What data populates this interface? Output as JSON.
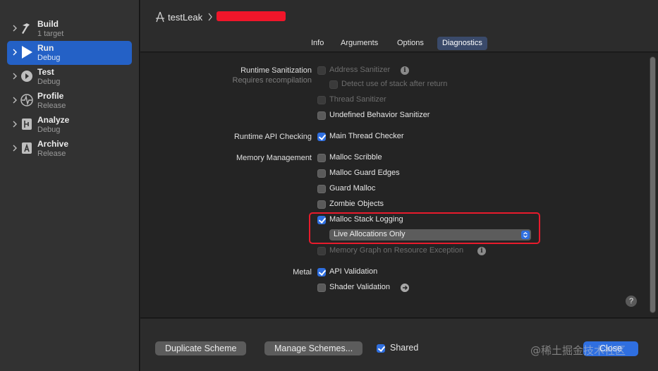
{
  "sidebar": {
    "items": [
      {
        "title": "Build",
        "subtitle": "1 target",
        "icon": "hammer-icon",
        "active": false
      },
      {
        "title": "Run",
        "subtitle": "Debug",
        "icon": "play-icon",
        "active": true
      },
      {
        "title": "Test",
        "subtitle": "Debug",
        "icon": "test-diamond-icon",
        "active": false
      },
      {
        "title": "Profile",
        "subtitle": "Release",
        "icon": "waveform-icon",
        "active": false
      },
      {
        "title": "Analyze",
        "subtitle": "Debug",
        "icon": "analyze-icon",
        "active": false
      },
      {
        "title": "Archive",
        "subtitle": "Release",
        "icon": "archive-icon",
        "active": false
      }
    ]
  },
  "header": {
    "scheme_name": "testLeak"
  },
  "tabs": [
    "Info",
    "Arguments",
    "Options",
    "Diagnostics"
  ],
  "active_tab": "Diagnostics",
  "sections": {
    "runtime_sanitization": {
      "label": "Runtime Sanitization",
      "sublabel": "Requires recompilation",
      "address_sanitizer": "Address Sanitizer",
      "detect_stack": "Detect use of stack after return",
      "thread_sanitizer": "Thread Sanitizer",
      "ub_sanitizer": "Undefined Behavior Sanitizer"
    },
    "runtime_api": {
      "label": "Runtime API Checking",
      "main_thread_checker": "Main Thread Checker"
    },
    "memory": {
      "label": "Memory Management",
      "malloc_scribble": "Malloc Scribble",
      "malloc_guard_edges": "Malloc Guard Edges",
      "guard_malloc": "Guard Malloc",
      "zombie_objects": "Zombie Objects",
      "malloc_stack_logging": "Malloc Stack Logging",
      "stack_logging_mode": "Live Allocations Only",
      "memory_graph": "Memory Graph on Resource Exception"
    },
    "metal": {
      "label": "Metal",
      "api_validation": "API Validation",
      "shader_validation": "Shader Validation"
    }
  },
  "footer": {
    "duplicate": "Duplicate Scheme",
    "manage": "Manage Schemes...",
    "shared": "Shared",
    "close": "Close",
    "watermark": "@稀土掘金技术社区"
  },
  "colors": {
    "accent": "#2f6fe0",
    "selection": "#2461c6",
    "highlight": "#e81b2c",
    "redaction": "#f0162a"
  }
}
